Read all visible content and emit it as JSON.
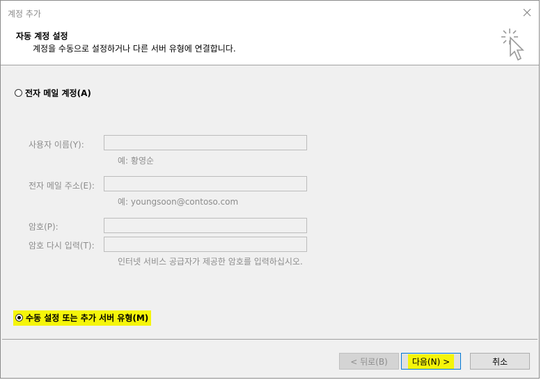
{
  "window": {
    "title": "계정 추가"
  },
  "header": {
    "title": "자동 계정 설정",
    "subtitle": "계정을 수동으로 설정하거나 다른 서버 유형에 연결합니다."
  },
  "options": {
    "email_account_label": "전자 메일 계정(A)",
    "manual_setup_label": "수동 설정 또는 추가 서버 유형(M)",
    "selected": "manual_setup"
  },
  "form": {
    "user_name_label": "사용자 이름(Y):",
    "user_name_value": "",
    "user_name_hint": "예: 황영순",
    "email_label": "전자 메일 주소(E):",
    "email_value": "",
    "email_hint": "예: youngsoon@contoso.com",
    "password_label": "암호(P):",
    "password_value": "",
    "retype_label": "암호 다시 입력(T):",
    "retype_value": "",
    "password_hint": "인터넷 서비스 공급자가 제공한 암호를 입력하십시오."
  },
  "buttons": {
    "back": "< 뒤로(B)",
    "next": "다음(N) >",
    "cancel": "취소"
  },
  "colors": {
    "highlight": "#f5f50a",
    "dialog_bg": "#f0f0f0"
  },
  "icons": {
    "close": "close-icon",
    "header": "cursor-click-icon"
  }
}
